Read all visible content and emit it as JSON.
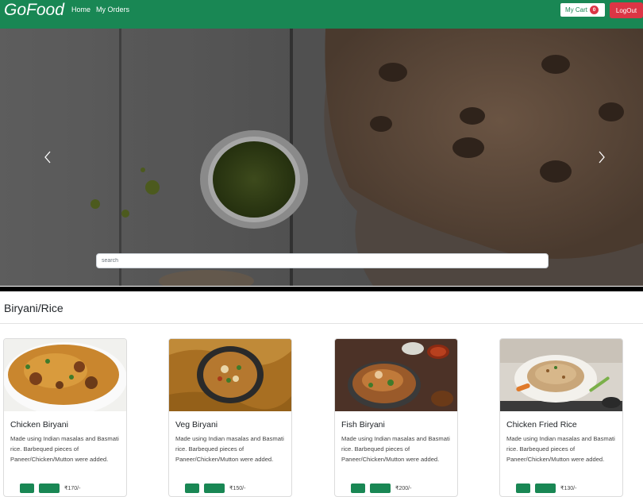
{
  "navbar": {
    "brand": "GoFood",
    "links": [
      "Home",
      "My Orders"
    ],
    "cart_label": "My Cart",
    "cart_count": "0",
    "logout_label": "LogOut",
    "accent_color": "#198754",
    "danger_color": "#dc3545"
  },
  "carousel": {
    "search_placeholder": "search",
    "prev_icon": "chevron-left-icon",
    "next_icon": "chevron-right-icon"
  },
  "category": {
    "title": "Biryani/Rice",
    "items": [
      {
        "name": "Chicken Biryani",
        "description": "Made using Indian masalas and Basmati rice. Barbequed pieces of Paneer/Chicken/Mutton were added.",
        "price": "₹170/-"
      },
      {
        "name": "Veg Biryani",
        "description": "Made using Indian masalas and Basmati rice. Barbequed pieces of Paneer/Chicken/Mutton were added.",
        "price": "₹150/-"
      },
      {
        "name": "Fish Biryani",
        "description": "Made using Indian masalas and Basmati rice. Barbequed pieces of Paneer/Chicken/Mutton were added.",
        "price": "₹200/-"
      },
      {
        "name": "Chicken Fried Rice",
        "description": "Made using Indian masalas and Basmati rice. Barbequed pieces of Paneer/Chicken/Mutton were added.",
        "price": "₹130/-"
      }
    ]
  }
}
